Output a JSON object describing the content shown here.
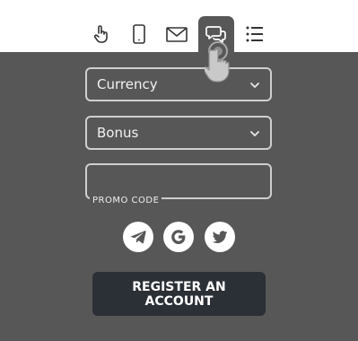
{
  "tabs": [
    {
      "icon": "tap-hand-icon",
      "active": false
    },
    {
      "icon": "mobile-phone-icon",
      "active": false
    },
    {
      "icon": "email-envelope-icon",
      "active": false
    },
    {
      "icon": "chat-bubbles-icon",
      "active": true
    },
    {
      "icon": "list-icon",
      "active": false
    }
  ],
  "form": {
    "currency_select": "Currency",
    "bonus_select": "Bonus",
    "promo_code_label": "PROMO CODE",
    "promo_code_value": ""
  },
  "social": [
    {
      "icon": "telegram-icon"
    },
    {
      "icon": "google-icon"
    },
    {
      "icon": "twitter-icon"
    }
  ],
  "register_button": "REGISTER AN ACCOUNT",
  "colors": {
    "panel": "#575757",
    "button": "#2b2f36",
    "field_border": "#cfcfcf",
    "tabbar": "#ffffff"
  }
}
